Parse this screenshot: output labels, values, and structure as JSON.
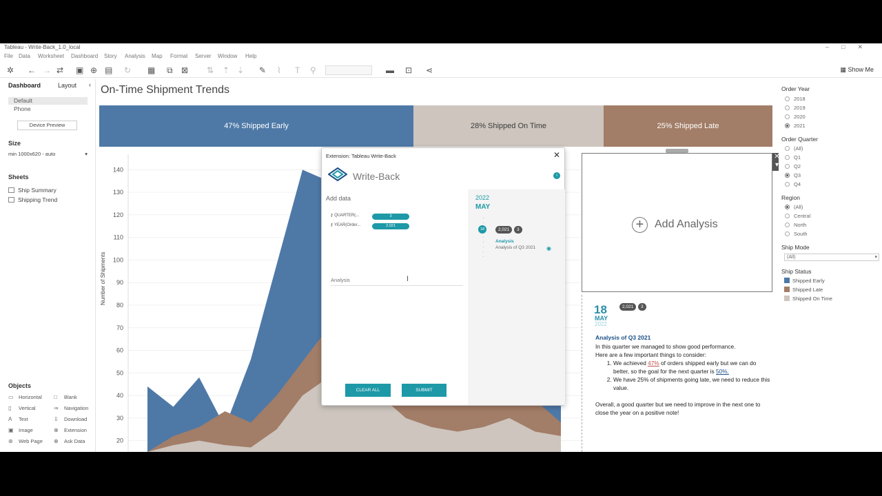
{
  "window": {
    "title": "Tableau - Write-Back_1.0_local",
    "menu": [
      "File",
      "Data",
      "Worksheet",
      "Dashboard",
      "Story",
      "Analysis",
      "Map",
      "Format",
      "Server",
      "Window",
      "Help"
    ],
    "show_me": "Show Me"
  },
  "left_pane": {
    "tabs": [
      "Dashboard",
      "Layout"
    ],
    "devices": [
      "Default",
      "Phone"
    ],
    "device_preview": "Device Preview",
    "size_heading": "Size",
    "size_value": "min 1000x620 - auto",
    "sheets_heading": "Sheets",
    "sheets": [
      "Ship Summary",
      "Shipping Trend"
    ],
    "objects_heading": "Objects",
    "objects": [
      "Horizontal",
      "Blank",
      "Vertical",
      "Navigation",
      "Text",
      "Download",
      "Image",
      "Extension",
      "Web Page",
      "Ask Data"
    ]
  },
  "dashboard": {
    "title": "On-Time Shipment Trends",
    "banners": [
      "47% Shipped Early",
      "28% Shipped On Time",
      "25% Shipped Late"
    ],
    "add_analysis": "Add Analysis"
  },
  "chart_data": {
    "type": "area",
    "ylabel": "Number of Shipments",
    "yticks": [
      20,
      30,
      40,
      50,
      60,
      70,
      80,
      90,
      100,
      110,
      120,
      130,
      140
    ],
    "ylim": [
      15,
      145
    ],
    "colors": {
      "early": "#4e79a7",
      "late": "#a27d67",
      "ontime": "#cdc5be"
    },
    "series": [
      {
        "name": "Shipped On Time",
        "values": [
          15,
          18,
          20,
          18,
          17,
          25,
          40,
          48,
          44,
          40,
          30,
          26,
          24,
          26,
          30,
          24,
          22
        ]
      },
      {
        "name": "Shipped Late",
        "values": [
          15,
          22,
          26,
          33,
          28,
          40,
          55,
          70,
          62,
          58,
          45,
          40,
          36,
          40,
          45,
          38,
          28
        ]
      },
      {
        "name": "Shipped Early",
        "values": [
          44,
          35,
          48,
          26,
          56,
          98,
          140,
          135,
          132,
          110,
          90,
          75,
          60,
          58,
          70,
          55,
          40
        ]
      }
    ]
  },
  "analysis_entry": {
    "day": "18",
    "month": "MAY",
    "year": "2022",
    "tags": [
      "2,021",
      "3"
    ],
    "title": "Analysis of Q3 2021",
    "line1": "In this quarter we managed to show good performance.",
    "line2": "Here are a few important things to consider:",
    "item1_pre": "We achieved ",
    "item1_pct": "47%",
    "item1_mid": " of orders shipped early but we can do better, so the goal for the next quarter is ",
    "item1_goal": "50%.",
    "item2": "We have 25% of shipments going late, we need to reduce this value.",
    "closing": "Overall, a good quarter but we need to improve in the next one to close the year on a positive note!"
  },
  "filters": {
    "order_year": {
      "label": "Order Year",
      "options": [
        "2018",
        "2019",
        "2020",
        "2021"
      ],
      "selected": "2021"
    },
    "order_quarter": {
      "label": "Order Quarter",
      "options": [
        "(All)",
        "Q1",
        "Q2",
        "Q3",
        "Q4"
      ],
      "selected": "Q3"
    },
    "region": {
      "label": "Region",
      "options": [
        "(All)",
        "Central",
        "North",
        "South"
      ],
      "selected": "(All)"
    },
    "ship_mode": {
      "label": "Ship Mode",
      "value": "(All)"
    },
    "ship_status": {
      "label": "Ship Status",
      "items": [
        "Shipped Early",
        "Shipped Late",
        "Shipped On Time"
      ]
    }
  },
  "dialog": {
    "title": "Extension: Tableau Write-Back",
    "app_name": "Write-Back",
    "add_data": "Add data",
    "fields": [
      {
        "label": "QUARTER(...",
        "value": "3"
      },
      {
        "label": "YEAR(Order...",
        "value": "2,021"
      }
    ],
    "analysis_placeholder": "Analysis",
    "clear_all": "CLEAR ALL",
    "submit": "SUBMIT",
    "timeline_year": "2022",
    "timeline_month": "MAY",
    "timeline_day": "18",
    "timeline_tags": [
      "2,021",
      "3"
    ],
    "timeline_item_title": "Analysis",
    "timeline_item_desc": "Analysis of Q3 2021"
  }
}
